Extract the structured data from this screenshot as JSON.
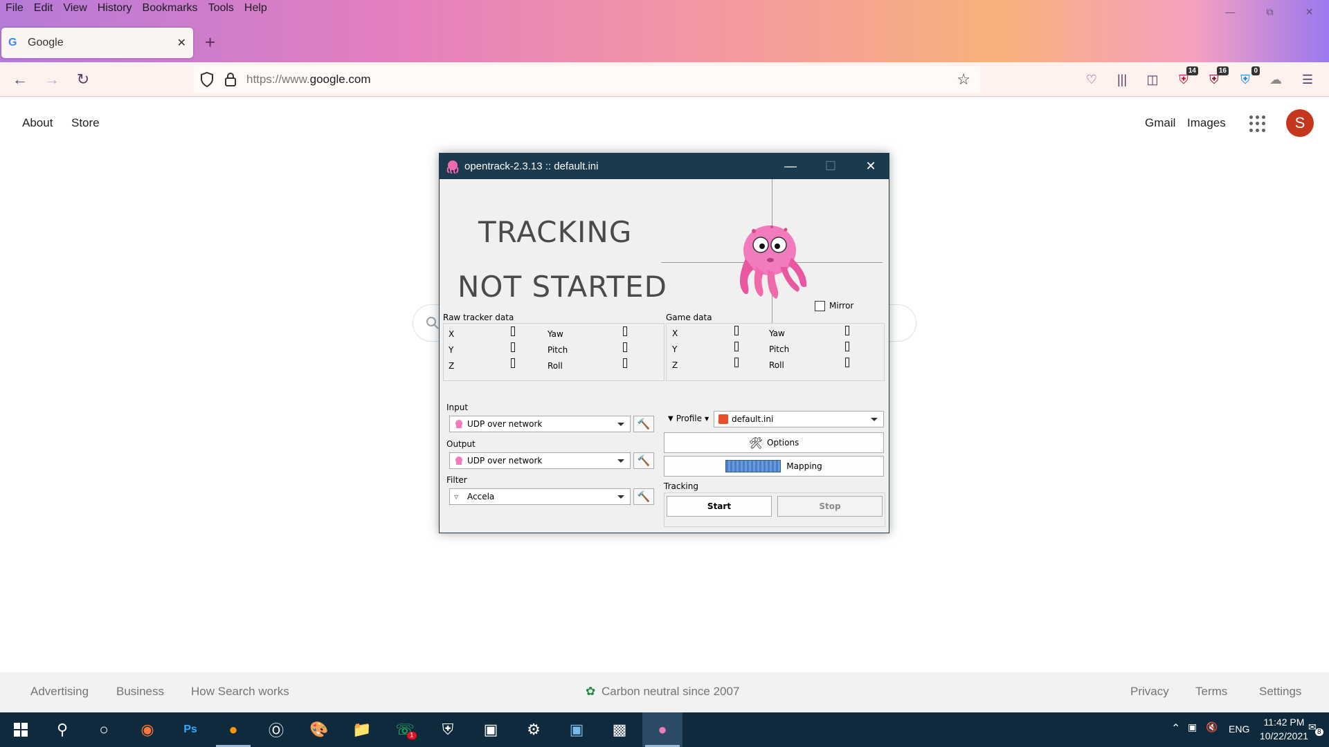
{
  "browser": {
    "menu": [
      "File",
      "Edit",
      "View",
      "History",
      "Bookmarks",
      "Tools",
      "Help"
    ],
    "tab_title": "Google",
    "url_prefix": "https://www.",
    "url_host": "google.com",
    "badges": {
      "ext1": "14",
      "ext2": "16",
      "ext3": "0"
    }
  },
  "google": {
    "about": "About",
    "store": "Store",
    "gmail": "Gmail",
    "images": "Images",
    "avatar_letter": "S",
    "footer": {
      "advertising": "Advertising",
      "business": "Business",
      "how_search_works": "How Search works",
      "carbon": "Carbon neutral since 2007",
      "privacy": "Privacy",
      "terms": "Terms",
      "settings": "Settings"
    }
  },
  "opentrack": {
    "title": "opentrack-2.3.13 :: default.ini",
    "status_line1": "TRACKING",
    "status_line2": "NOT STARTED",
    "mirror_label": "Mirror",
    "raw_label": "Raw tracker data",
    "game_label": "Game data",
    "axes": {
      "x": "X",
      "y": "Y",
      "z": "Z",
      "yaw": "Yaw",
      "pitch": "Pitch",
      "roll": "Roll"
    },
    "input_label": "Input",
    "input_value": "UDP over network",
    "output_label": "Output",
    "output_value": "UDP over network",
    "filter_label": "Filter",
    "filter_value": "Accela",
    "profile_label": "Profile",
    "profile_value": "default.ini",
    "options_label": "Options",
    "mapping_label": "Mapping",
    "tracking_label": "Tracking",
    "start_label": "Start",
    "stop_label": "Stop"
  },
  "tray": {
    "lang": "ENG",
    "time": "11:42 PM",
    "date": "10/22/2021",
    "notif_count": "8",
    "whatsapp_count": "1"
  }
}
